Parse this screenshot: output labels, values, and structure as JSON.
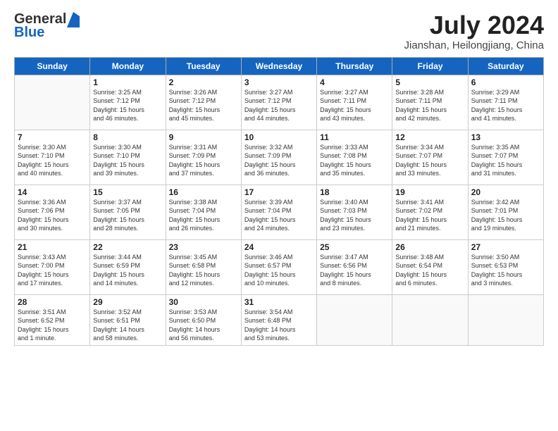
{
  "header": {
    "logo_general": "General",
    "logo_blue": "Blue",
    "month_title": "July 2024",
    "location": "Jianshan, Heilongjiang, China"
  },
  "days_of_week": [
    "Sunday",
    "Monday",
    "Tuesday",
    "Wednesday",
    "Thursday",
    "Friday",
    "Saturday"
  ],
  "weeks": [
    [
      {
        "day": "",
        "info": ""
      },
      {
        "day": "1",
        "info": "Sunrise: 3:25 AM\nSunset: 7:12 PM\nDaylight: 15 hours\nand 46 minutes."
      },
      {
        "day": "2",
        "info": "Sunrise: 3:26 AM\nSunset: 7:12 PM\nDaylight: 15 hours\nand 45 minutes."
      },
      {
        "day": "3",
        "info": "Sunrise: 3:27 AM\nSunset: 7:12 PM\nDaylight: 15 hours\nand 44 minutes."
      },
      {
        "day": "4",
        "info": "Sunrise: 3:27 AM\nSunset: 7:11 PM\nDaylight: 15 hours\nand 43 minutes."
      },
      {
        "day": "5",
        "info": "Sunrise: 3:28 AM\nSunset: 7:11 PM\nDaylight: 15 hours\nand 42 minutes."
      },
      {
        "day": "6",
        "info": "Sunrise: 3:29 AM\nSunset: 7:11 PM\nDaylight: 15 hours\nand 41 minutes."
      }
    ],
    [
      {
        "day": "7",
        "info": "Sunrise: 3:30 AM\nSunset: 7:10 PM\nDaylight: 15 hours\nand 40 minutes."
      },
      {
        "day": "8",
        "info": "Sunrise: 3:30 AM\nSunset: 7:10 PM\nDaylight: 15 hours\nand 39 minutes."
      },
      {
        "day": "9",
        "info": "Sunrise: 3:31 AM\nSunset: 7:09 PM\nDaylight: 15 hours\nand 37 minutes."
      },
      {
        "day": "10",
        "info": "Sunrise: 3:32 AM\nSunset: 7:09 PM\nDaylight: 15 hours\nand 36 minutes."
      },
      {
        "day": "11",
        "info": "Sunrise: 3:33 AM\nSunset: 7:08 PM\nDaylight: 15 hours\nand 35 minutes."
      },
      {
        "day": "12",
        "info": "Sunrise: 3:34 AM\nSunset: 7:07 PM\nDaylight: 15 hours\nand 33 minutes."
      },
      {
        "day": "13",
        "info": "Sunrise: 3:35 AM\nSunset: 7:07 PM\nDaylight: 15 hours\nand 31 minutes."
      }
    ],
    [
      {
        "day": "14",
        "info": "Sunrise: 3:36 AM\nSunset: 7:06 PM\nDaylight: 15 hours\nand 30 minutes."
      },
      {
        "day": "15",
        "info": "Sunrise: 3:37 AM\nSunset: 7:05 PM\nDaylight: 15 hours\nand 28 minutes."
      },
      {
        "day": "16",
        "info": "Sunrise: 3:38 AM\nSunset: 7:04 PM\nDaylight: 15 hours\nand 26 minutes."
      },
      {
        "day": "17",
        "info": "Sunrise: 3:39 AM\nSunset: 7:04 PM\nDaylight: 15 hours\nand 24 minutes."
      },
      {
        "day": "18",
        "info": "Sunrise: 3:40 AM\nSunset: 7:03 PM\nDaylight: 15 hours\nand 23 minutes."
      },
      {
        "day": "19",
        "info": "Sunrise: 3:41 AM\nSunset: 7:02 PM\nDaylight: 15 hours\nand 21 minutes."
      },
      {
        "day": "20",
        "info": "Sunrise: 3:42 AM\nSunset: 7:01 PM\nDaylight: 15 hours\nand 19 minutes."
      }
    ],
    [
      {
        "day": "21",
        "info": "Sunrise: 3:43 AM\nSunset: 7:00 PM\nDaylight: 15 hours\nand 17 minutes."
      },
      {
        "day": "22",
        "info": "Sunrise: 3:44 AM\nSunset: 6:59 PM\nDaylight: 15 hours\nand 14 minutes."
      },
      {
        "day": "23",
        "info": "Sunrise: 3:45 AM\nSunset: 6:58 PM\nDaylight: 15 hours\nand 12 minutes."
      },
      {
        "day": "24",
        "info": "Sunrise: 3:46 AM\nSunset: 6:57 PM\nDaylight: 15 hours\nand 10 minutes."
      },
      {
        "day": "25",
        "info": "Sunrise: 3:47 AM\nSunset: 6:56 PM\nDaylight: 15 hours\nand 8 minutes."
      },
      {
        "day": "26",
        "info": "Sunrise: 3:48 AM\nSunset: 6:54 PM\nDaylight: 15 hours\nand 6 minutes."
      },
      {
        "day": "27",
        "info": "Sunrise: 3:50 AM\nSunset: 6:53 PM\nDaylight: 15 hours\nand 3 minutes."
      }
    ],
    [
      {
        "day": "28",
        "info": "Sunrise: 3:51 AM\nSunset: 6:52 PM\nDaylight: 15 hours\nand 1 minute."
      },
      {
        "day": "29",
        "info": "Sunrise: 3:52 AM\nSunset: 6:51 PM\nDaylight: 14 hours\nand 58 minutes."
      },
      {
        "day": "30",
        "info": "Sunrise: 3:53 AM\nSunset: 6:50 PM\nDaylight: 14 hours\nand 56 minutes."
      },
      {
        "day": "31",
        "info": "Sunrise: 3:54 AM\nSunset: 6:48 PM\nDaylight: 14 hours\nand 53 minutes."
      },
      {
        "day": "",
        "info": ""
      },
      {
        "day": "",
        "info": ""
      },
      {
        "day": "",
        "info": ""
      }
    ]
  ]
}
